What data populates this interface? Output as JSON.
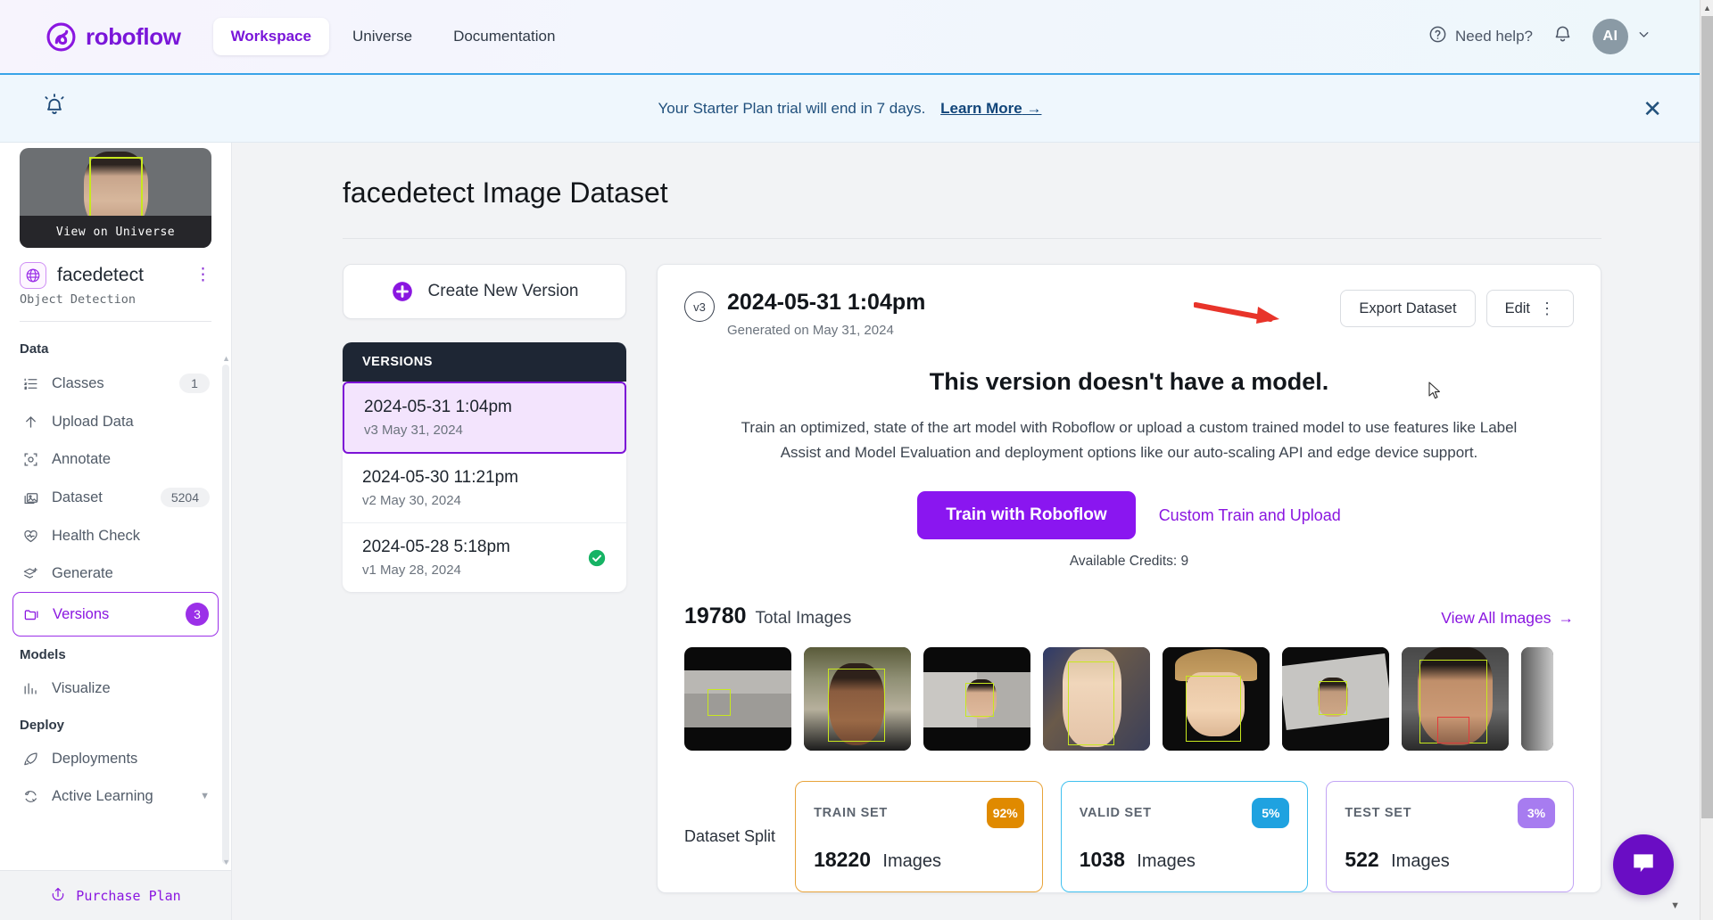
{
  "topnav": {
    "brand": "roboflow",
    "brand_icon": "roboflow-logo-icon",
    "links": [
      {
        "label": "Workspace",
        "active": true
      },
      {
        "label": "Universe",
        "active": false
      },
      {
        "label": "Documentation",
        "active": false
      }
    ],
    "need_help": "Need help?",
    "help_icon": "question-circle-icon",
    "bell_icon": "bell-icon",
    "avatar_initials": "AI",
    "avatar_caret_icon": "chevron-down-icon",
    "accent_color": "#7a16d9"
  },
  "banner": {
    "icon": "alert-bell-icon",
    "message": "Your Starter Plan trial will end in 7 days.",
    "link": "Learn More",
    "link_arrow": "arrow-right-icon",
    "close_icon": "close-icon",
    "border_color": "#39a4e8",
    "bg_color": "#eff7fd"
  },
  "sidebar": {
    "thumbnail_overlay": "View on Universe",
    "project_name": "facedetect",
    "project_icon": "globe-icon",
    "project_menu_icon": "kebab-menu-icon",
    "project_type": "Object Detection",
    "groups": [
      {
        "label": "Data",
        "items": [
          {
            "label": "Classes",
            "icon": "list-icon",
            "count": "1",
            "active": false
          },
          {
            "label": "Upload Data",
            "icon": "upload-arrow-icon",
            "count": "",
            "active": false
          },
          {
            "label": "Annotate",
            "icon": "annotate-box-icon",
            "count": "",
            "active": false
          },
          {
            "label": "Dataset",
            "icon": "images-icon",
            "count": "5204",
            "active": false
          },
          {
            "label": "Health Check",
            "icon": "heart-pulse-icon",
            "count": "",
            "active": false
          },
          {
            "label": "Generate",
            "icon": "layers-plus-icon",
            "count": "",
            "active": false
          },
          {
            "label": "Versions",
            "icon": "folders-icon",
            "count": "3",
            "active": true
          }
        ]
      },
      {
        "label": "Models",
        "items": [
          {
            "label": "Visualize",
            "icon": "bar-chart-icon",
            "count": "",
            "active": false
          }
        ]
      },
      {
        "label": "Deploy",
        "items": [
          {
            "label": "Deployments",
            "icon": "rocket-icon",
            "count": "",
            "active": false
          },
          {
            "label": "Active Learning",
            "icon": "recycle-icon",
            "count": "",
            "active": false,
            "caret": true
          }
        ]
      }
    ],
    "purchase_plan": "Purchase Plan",
    "purchase_icon": "upload-circle-icon"
  },
  "main": {
    "page_title": "facedetect Image Dataset",
    "create_version_button": "Create New Version",
    "create_version_icon": "plus-circle-icon",
    "versions_header": "VERSIONS",
    "versions": [
      {
        "title": "2024-05-31 1:04pm",
        "subtitle": "v3 May 31, 2024",
        "selected": true,
        "checked": false
      },
      {
        "title": "2024-05-30 11:21pm",
        "subtitle": "v2 May 30, 2024",
        "selected": false,
        "checked": false
      },
      {
        "title": "2024-05-28 5:18pm",
        "subtitle": "v1 May 28, 2024",
        "selected": false,
        "checked": true
      }
    ],
    "detail": {
      "version_chip": "v3",
      "title": "2024-05-31 1:04pm",
      "generated_on": "Generated on May 31, 2024",
      "export_button": "Export Dataset",
      "edit_button": "Edit",
      "edit_menu_icon": "kebab-menu-icon"
    },
    "no_model": {
      "title": "This version doesn't have a model.",
      "description": "Train an optimized, state of the art model with Roboflow or upload a custom trained model to use features like Label Assist and Model Evaluation and deployment options like our auto-scaling API and edge device support.",
      "primary_button": "Train with Roboflow",
      "secondary_link": "Custom Train and Upload",
      "credits_label": "Available Credits:",
      "credits_value": "9"
    },
    "images": {
      "total_count": "19780",
      "total_label": "Total Images",
      "view_all": "View All Images",
      "view_all_icon": "arrow-right-icon",
      "thumbnail_count": 8
    },
    "dataset_split": {
      "label": "Dataset Split",
      "cards": [
        {
          "name": "TRAIN SET",
          "percent": "92%",
          "count": "18220",
          "unit": "Images",
          "color": "#e08a00",
          "border": "#e8a33a"
        },
        {
          "name": "VALID SET",
          "percent": "5%",
          "count": "1038",
          "unit": "Images",
          "color": "#1fa2e0",
          "border": "#3fc0ef"
        },
        {
          "name": "TEST SET",
          "percent": "3%",
          "count": "522",
          "unit": "Images",
          "color": "#a77cf0",
          "border": "#c2a4f5"
        }
      ]
    },
    "annotation_arrow": "red-arrow-pointing-to-export-dataset",
    "chat_icon": "chat-bubble-icon"
  }
}
